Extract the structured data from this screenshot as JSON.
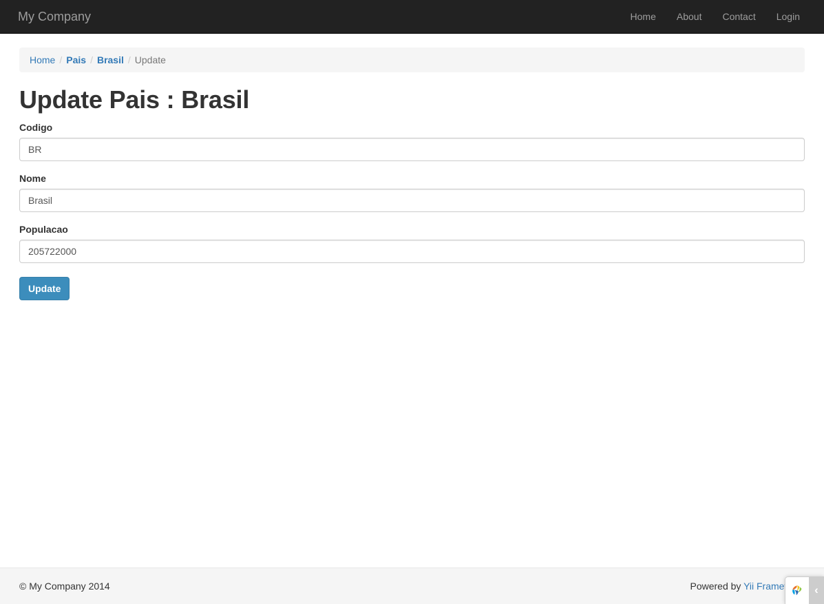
{
  "navbar": {
    "brand": "My Company",
    "items": [
      {
        "label": "Home",
        "name": "nav-home"
      },
      {
        "label": "About",
        "name": "nav-about"
      },
      {
        "label": "Contact",
        "name": "nav-contact"
      },
      {
        "label": "Login",
        "name": "nav-login"
      }
    ]
  },
  "breadcrumb": {
    "separator": "/",
    "items": [
      {
        "label": "Home",
        "link": true,
        "bold": false
      },
      {
        "label": "Pais",
        "link": true,
        "bold": true
      },
      {
        "label": "Brasil",
        "link": true,
        "bold": true
      },
      {
        "label": "Update",
        "link": false,
        "bold": false
      }
    ]
  },
  "main": {
    "title": "Update Pais : Brasil",
    "form": {
      "fields": [
        {
          "label": "Codigo",
          "value": "BR",
          "placeholder": ""
        },
        {
          "label": "Nome",
          "value": "Brasil",
          "placeholder": ""
        },
        {
          "label": "Populacao",
          "value": "205722000",
          "placeholder": ""
        }
      ],
      "submit_label": "Update"
    }
  },
  "footer": {
    "copyright": "© My Company 2014",
    "powered_prefix": "Powered by ",
    "powered_link": "Yii Framework"
  },
  "debug_toolbar": {
    "logo_icon": "yii-logo-icon",
    "toggle_label": "‹"
  },
  "colors": {
    "navbar_bg": "#222222",
    "navbar_text": "#9d9d9d",
    "link": "#337ab7",
    "breadcrumb_bg": "#f5f5f5",
    "breadcrumb_active": "#777777",
    "button_primary": "#3c8dbc",
    "footer_bg": "#f5f5f5",
    "input_border": "#cccccc",
    "text": "#333333"
  }
}
